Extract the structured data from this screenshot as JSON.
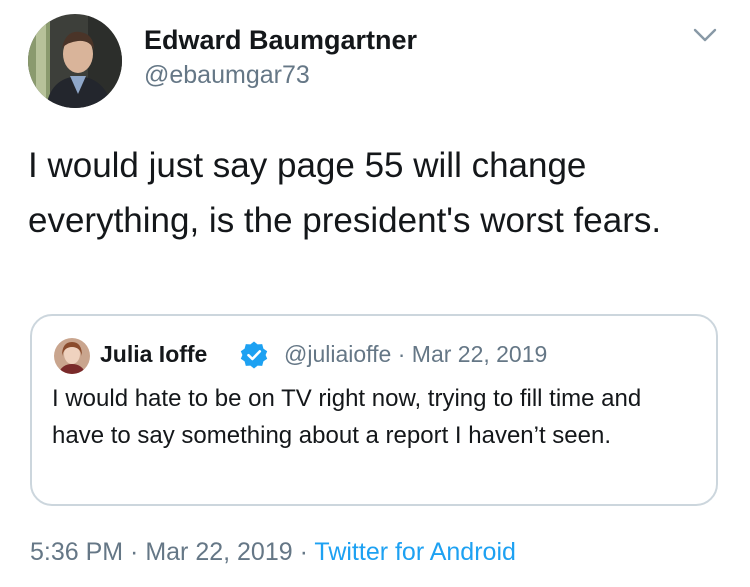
{
  "author": {
    "display_name": "Edward Baumgartner",
    "handle": "@ebaumgar73",
    "avatar_icon": "person-photo-icon"
  },
  "tweet": {
    "text": "I would just say page 55 will change everything, is the president's worst fears."
  },
  "quoted_tweet": {
    "display_name": "Julia Ioffe",
    "verified": true,
    "handle": "@juliaioffe",
    "separator": " · ",
    "date": "Mar 22, 2019",
    "text": "I would hate to be on TV right now, trying to fill time and have to say something about a report I haven’t seen."
  },
  "footer": {
    "time": "5:36 PM",
    "separator": " · ",
    "date": "Mar 22, 2019",
    "source": "Twitter for Android"
  },
  "icons": {
    "caret": "chevron-down-icon",
    "verified": "verified-badge-icon"
  },
  "colors": {
    "text": "#14171a",
    "secondary_text": "#657786",
    "link": "#1da1f2",
    "verified_badge": "#1da1f2",
    "quote_border": "#ccd6dd",
    "background": "#ffffff"
  }
}
